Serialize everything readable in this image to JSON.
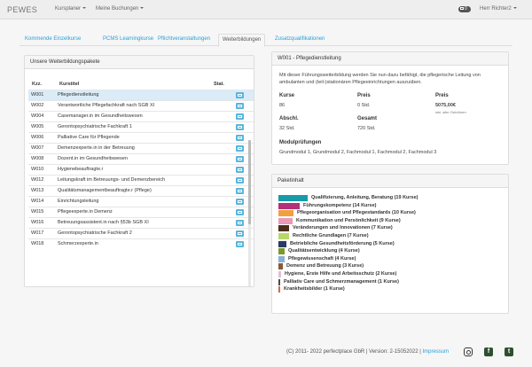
{
  "navbar": {
    "brand": "PEWES",
    "menus": [
      {
        "label": "Kursplaner"
      },
      {
        "label": "Meine Buchungen"
      }
    ],
    "messages_count": "0",
    "user": "Herr Richter2"
  },
  "tabs": [
    {
      "label": "Kommende Einzelkurse"
    },
    {
      "label": "PCMS Learningkurse"
    },
    {
      "label": "Pflichtveranstaltungen"
    },
    {
      "label": "Weiterbildungen"
    },
    {
      "label": "Zusatzqualifikationen"
    }
  ],
  "packages": {
    "heading": "Unsere Weiterbildungspakete",
    "columns": {
      "code": "Kzz.",
      "title": "Kurstitel",
      "status": "Stat."
    },
    "rows": [
      {
        "code": "W001",
        "title": "Pflegedienstleitung"
      },
      {
        "code": "W002",
        "title": "Verantwortliche Pflegefachkraft nach SGB XI"
      },
      {
        "code": "W004",
        "title": "Casemanager.in im Gesundheitswesen"
      },
      {
        "code": "W005",
        "title": "Gerontopsychiatrische Fachkraft 1"
      },
      {
        "code": "W006",
        "title": "Palliative Care für Pflegende"
      },
      {
        "code": "W007",
        "title": "Demenzexperte.in in der Betreuung"
      },
      {
        "code": "W008",
        "title": "Dozent.in im Gesundheitswesen"
      },
      {
        "code": "W010",
        "title": "Hygienebeauftragte.r"
      },
      {
        "code": "W012",
        "title": "Leitungskraft im Betreuungs- und Demenzbereich"
      },
      {
        "code": "W013",
        "title": "Qualitätsmanagementbeauftragte.r (Pflege)"
      },
      {
        "code": "W014",
        "title": "Einrichtungsleitung"
      },
      {
        "code": "W015",
        "title": "Pflegeexperte.in Demenz"
      },
      {
        "code": "W016",
        "title": "Betreuungsassistent.in nach §53b SGB XI"
      },
      {
        "code": "W017",
        "title": "Gerontopsychiatrische Fachkraft 2"
      },
      {
        "code": "W018",
        "title": "Schmerzexperte.in"
      }
    ]
  },
  "detail": {
    "heading": "W001 - Pflegedienstleitung",
    "description": "Mit dieser Führungsweiterbildung werden Sie nun dazu befähigt, die pflegerische Leitung von ambulanten und (teil-)stationären Pflegeeinrichtungen auszuüben.",
    "kurse_label": "Kurse",
    "kurse_value": "86",
    "preis_label": "Preis",
    "preis_value": "0 Std.",
    "preis2_label": "Preis",
    "preis2_value": "5075,00€",
    "preis2_note": "inkl. aller Gebühren",
    "abschl_label": "Abschl.",
    "abschl_value": "32 Std.",
    "gesamt_label": "Gesamt",
    "gesamt_value": "720 Std.",
    "module_label": "Modulprüfungen",
    "module_value": "Grundmodul 1, Grundmodul 2, Fachmodul 1, Fachmodul 2, Fachmodul 3"
  },
  "content": {
    "heading": "Paketinhalt",
    "items": [
      {
        "label": "Qualifizierung, Anleitung, Beratung (19 Kurse)",
        "count": 19,
        "color": "#1a9aa8"
      },
      {
        "label": "Führungskompetenz (14 Kurse)",
        "count": 14,
        "color": "#b5307a"
      },
      {
        "label": "Pflegeorganisation und Pflegestandards (10 Kurse)",
        "count": 10,
        "color": "#f0a040"
      },
      {
        "label": "Kommunikation und Persönlichkeit (9 Kurse)",
        "count": 9,
        "color": "#e89ab8"
      },
      {
        "label": "Veränderungen und Innovationen (7 Kurse)",
        "count": 7,
        "color": "#4a2e1a"
      },
      {
        "label": "Rechtliche Grundlagen (7 Kurse)",
        "count": 7,
        "color": "#b8d86a"
      },
      {
        "label": "Betriebliche Gesundheitsförderung (5 Kurse)",
        "count": 5,
        "color": "#2a3a66"
      },
      {
        "label": "Qualitätsentwicklung (4 Kurse)",
        "count": 4,
        "color": "#7a9a2a"
      },
      {
        "label": "Pflegewissenschaft (4 Kurse)",
        "count": 4,
        "color": "#8ab0d8"
      },
      {
        "label": "Demenz und Betreuung (3 Kurse)",
        "count": 3,
        "color": "#8a5a3a"
      },
      {
        "label": "Hygiene, Erste Hilfe und Arbeitsschutz (2 Kurse)",
        "count": 2,
        "color": "#e0c0d0"
      },
      {
        "label": "Palliativ Care und Schmerzmanagement (1 Kurse)",
        "count": 1,
        "color": "#4a4a4a"
      },
      {
        "label": "Krankheitsbilder (1 Kurse)",
        "count": 1,
        "color": "#d06a4a"
      }
    ]
  },
  "footer": {
    "copyright": "(C) 2011- 2022 perfectplace GbR | Version: 2-15052022 |",
    "impressum": "Impressum"
  }
}
